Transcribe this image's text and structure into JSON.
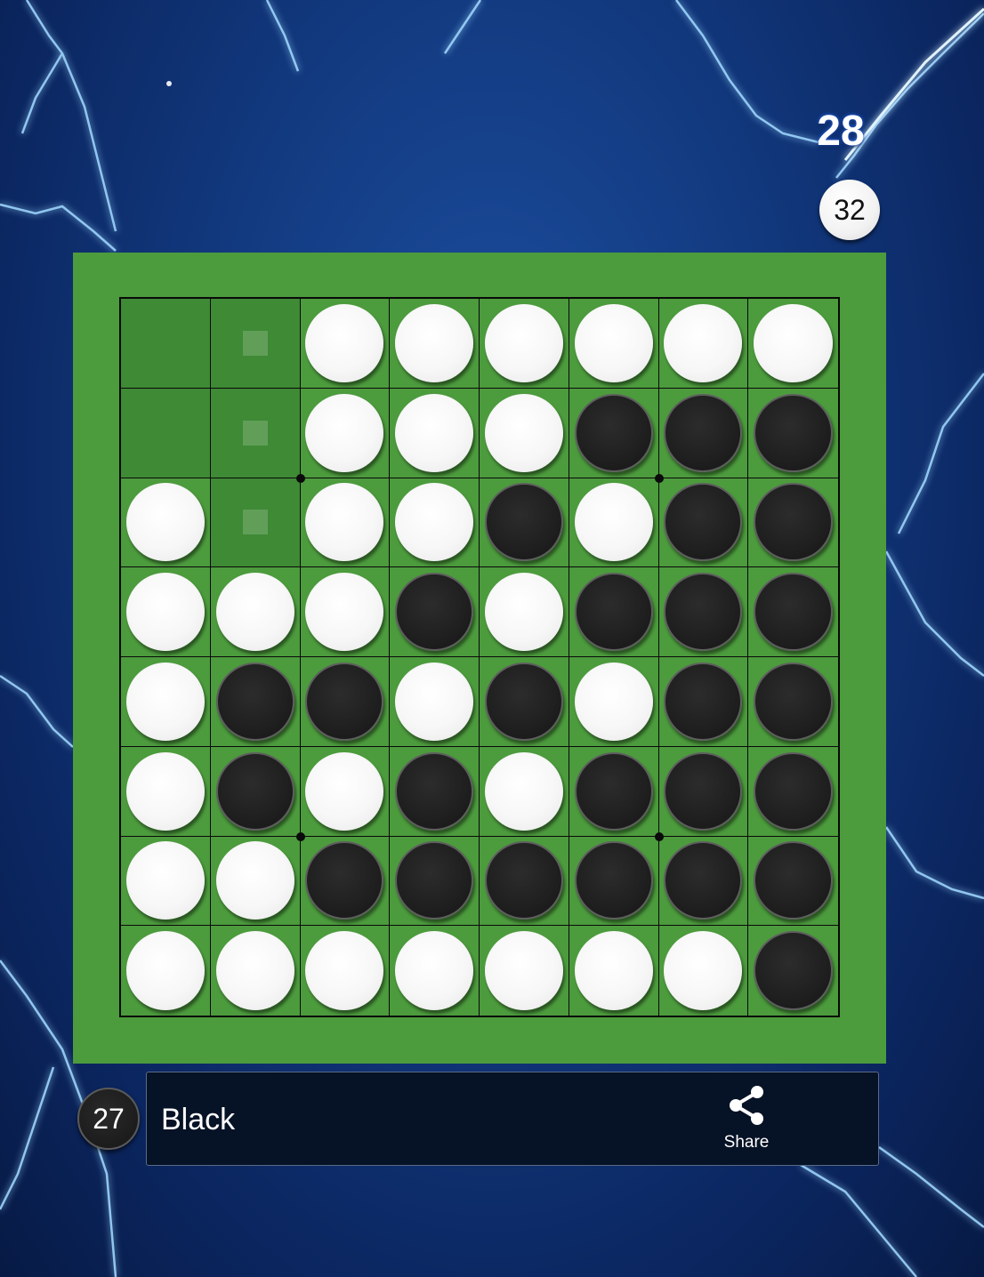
{
  "game": {
    "move_number": "28",
    "white_score": "32",
    "black_score": "27",
    "turn_label": "Black",
    "share_label": "Share",
    "icons": {
      "share": "share-icon"
    },
    "colors": {
      "board": "#4c9b3d",
      "grid_line": "#0a0a0a",
      "white_disc": "#f5f5f5",
      "black_disc": "#1c1c1c",
      "status_bar": "#061225"
    },
    "board": [
      [
        "E",
        "H",
        "W",
        "W",
        "W",
        "W",
        "W",
        "W"
      ],
      [
        "E",
        "H",
        "W",
        "W",
        "W",
        "B",
        "B",
        "B"
      ],
      [
        "W",
        "H",
        "W",
        "W",
        "B",
        "W",
        "B",
        "B"
      ],
      [
        "W",
        "W",
        "W",
        "B",
        "W",
        "B",
        "B",
        "B"
      ],
      [
        "W",
        "B",
        "B",
        "W",
        "B",
        "W",
        "B",
        "B"
      ],
      [
        "W",
        "B",
        "W",
        "B",
        "W",
        "B",
        "B",
        "B"
      ],
      [
        "W",
        "W",
        "B",
        "B",
        "B",
        "B",
        "B",
        "B"
      ],
      [
        "W",
        "W",
        "W",
        "W",
        "W",
        "W",
        "W",
        "B"
      ]
    ]
  }
}
